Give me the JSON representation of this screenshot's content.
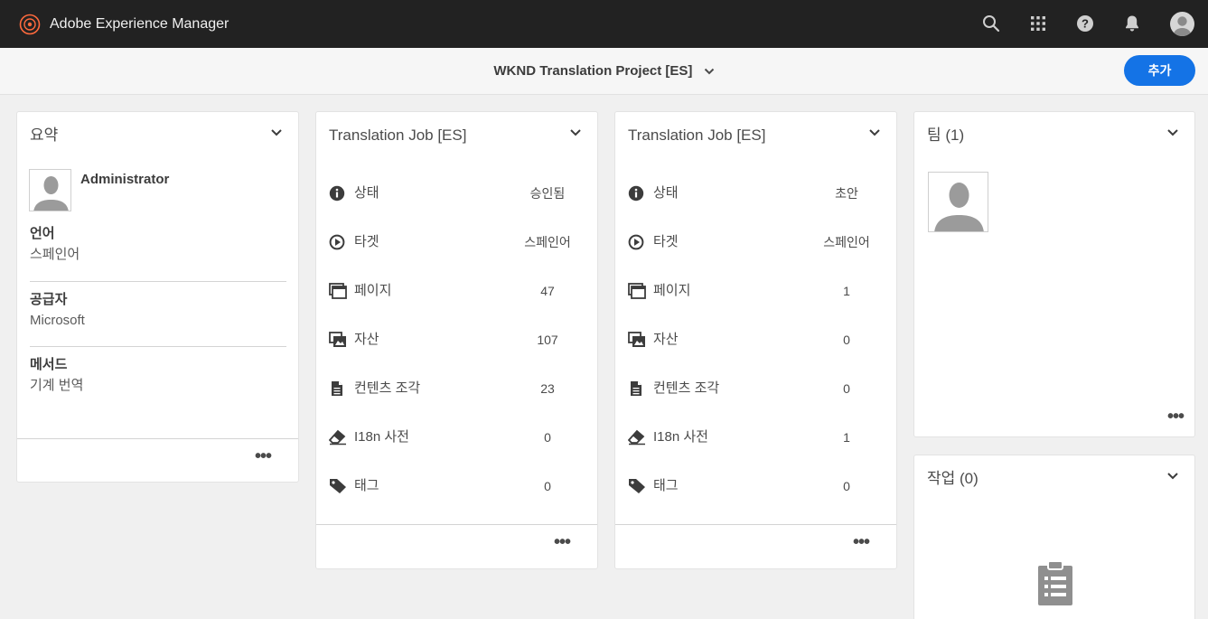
{
  "header": {
    "app_title": "Adobe Experience Manager",
    "icons": [
      "search-icon",
      "apps-grid-icon",
      "help-icon",
      "bell-icon",
      "user-avatar-icon"
    ]
  },
  "subheader": {
    "project_title": "WKND Translation Project [ES]",
    "add_label": "추가"
  },
  "summary": {
    "title": "요약",
    "user": "Administrator",
    "fields": [
      {
        "label": "언어",
        "value": "스페인어"
      },
      {
        "label": "공급자",
        "value": "Microsoft"
      },
      {
        "label": "메서드",
        "value": "기계 번역"
      }
    ]
  },
  "jobs": [
    {
      "title": "Translation Job [ES]",
      "rows": [
        {
          "icon": "info-icon",
          "label": "상태",
          "value": "승인됨"
        },
        {
          "icon": "play-icon",
          "label": "타겟",
          "value": "스페인어"
        },
        {
          "icon": "pages-icon",
          "label": "페이지",
          "value": "47"
        },
        {
          "icon": "assets-icon",
          "label": "자산",
          "value": "107"
        },
        {
          "icon": "document-icon",
          "label": "컨텐츠 조각",
          "value": "23"
        },
        {
          "icon": "eraser-icon",
          "label": "I18n 사전",
          "value": "0"
        },
        {
          "icon": "tag-icon",
          "label": "태그",
          "value": "0"
        }
      ]
    },
    {
      "title": "Translation Job [ES]",
      "rows": [
        {
          "icon": "info-icon",
          "label": "상태",
          "value": "초안"
        },
        {
          "icon": "play-icon",
          "label": "타겟",
          "value": "스페인어"
        },
        {
          "icon": "pages-icon",
          "label": "페이지",
          "value": "1"
        },
        {
          "icon": "assets-icon",
          "label": "자산",
          "value": "0"
        },
        {
          "icon": "document-icon",
          "label": "컨텐츠 조각",
          "value": "0"
        },
        {
          "icon": "eraser-icon",
          "label": "I18n 사전",
          "value": "1"
        },
        {
          "icon": "tag-icon",
          "label": "태그",
          "value": "0"
        }
      ]
    }
  ],
  "team": {
    "title": "팀 (1)"
  },
  "tasks": {
    "title": "작업 (0)"
  },
  "colors": {
    "topbar": "#222222",
    "accent": "#1473e6",
    "background": "#f0f0f0"
  }
}
